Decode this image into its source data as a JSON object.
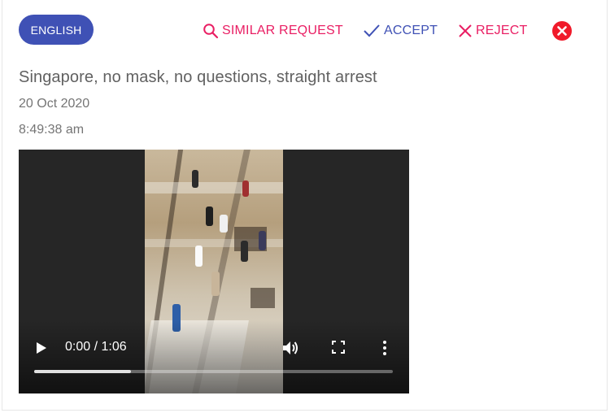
{
  "header": {
    "language": "ENGLISH",
    "similar_label": "SIMILAR REQUEST",
    "accept_label": "ACCEPT",
    "reject_label": "REJECT"
  },
  "post": {
    "title": "Singapore, no mask, no questions, straight arrest",
    "date": "20 Oct 2020",
    "time": "8:49:38 am"
  },
  "video": {
    "time_display": "0:00 / 1:06",
    "progress": 0.27
  },
  "colors": {
    "chip": "#3f51b5",
    "accent_pink": "#e91e63",
    "accent_indigo": "#3f51b5",
    "close": "#f01a2a"
  },
  "icons": {
    "similar": "search-icon",
    "accept": "check-icon",
    "reject": "x-icon",
    "close": "close-circle-icon",
    "play": "play-icon",
    "volume": "volume-icon",
    "fullscreen": "fullscreen-icon",
    "more": "more-vertical-icon"
  }
}
